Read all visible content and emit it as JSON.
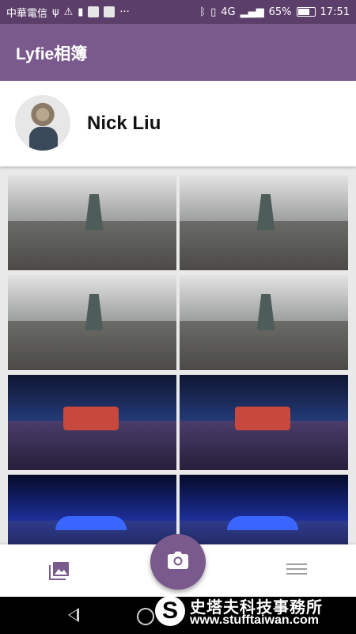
{
  "status_bar": {
    "carrier": "中華電信",
    "icons": [
      "usb-icon",
      "warning-icon",
      "battery-saver-icon",
      "app-notification-icon",
      "app-notification-icon",
      "more-icon"
    ],
    "right_icons": [
      "bluetooth-icon",
      "vibrate-icon",
      "signal-4g-icon"
    ],
    "network": "4G",
    "battery": "65%",
    "time": "17:51"
  },
  "app_bar": {
    "title": "Lyfie相簿"
  },
  "profile": {
    "name": "Nick Liu"
  },
  "photos": [
    {
      "scene": "cloudy-360"
    },
    {
      "scene": "cloudy-360"
    },
    {
      "scene": "cloudy-360"
    },
    {
      "scene": "cloudy-360"
    },
    {
      "scene": "night-stage-360"
    },
    {
      "scene": "night-stage-360"
    },
    {
      "scene": "blue-light-360"
    },
    {
      "scene": "blue-light-360"
    }
  ],
  "bottom_nav": {
    "left_icon": "gallery-icon",
    "center_icon": "camera-icon",
    "right_icon": "menu-icon"
  },
  "system_nav": {
    "back_icon": "back-icon",
    "home_icon": "home-icon"
  },
  "watermark": {
    "logo_letter": "S",
    "name": "史塔夫科技事務所",
    "url": "www.stufftaiwan.com"
  },
  "colors": {
    "status_bar": "#5b3f6a",
    "app_bar": "#7a5a8d",
    "fab": "#7a5a8d"
  }
}
